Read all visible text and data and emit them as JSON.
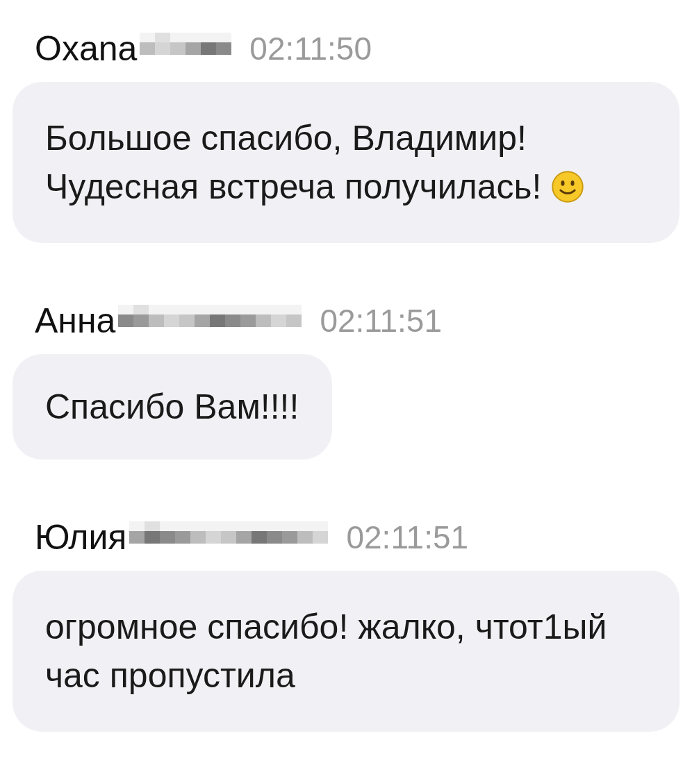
{
  "messages": [
    {
      "author": "Oxana",
      "surname_hidden": true,
      "time": "02:11:50",
      "lines": [
        "Большое спасибо, Владимир!",
        "Чудесная встреча получилась!"
      ],
      "ends_with_emoji": true
    },
    {
      "author": "Анна",
      "surname_hidden": true,
      "time": "02:11:51",
      "lines": [
        "Спасибо Вам!!!!"
      ],
      "ends_with_emoji": false
    },
    {
      "author": "Юлия",
      "surname_hidden": true,
      "time": "02:11:51",
      "lines": [
        "огромное спасибо! жалко, чтот1ый",
        "час пропустила"
      ],
      "ends_with_emoji": false
    }
  ]
}
